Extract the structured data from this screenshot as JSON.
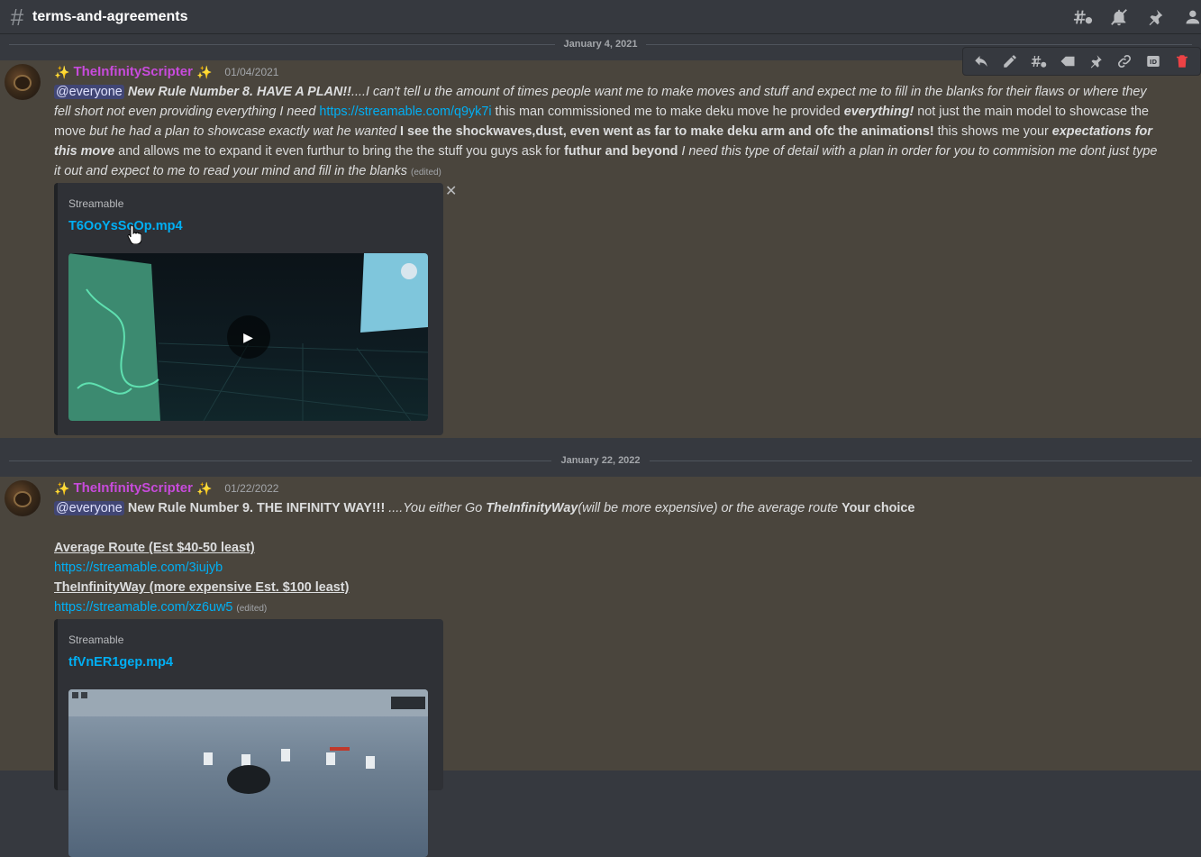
{
  "header": {
    "channel_name": "terms-and-agreements"
  },
  "messages": [
    {
      "date_divider": "January 4, 2021",
      "author": "TheInfinityScripter",
      "timestamp": "01/04/2021",
      "mention": "@everyone",
      "segments": {
        "s1": "New Rule Number 8. HAVE A PLAN!!",
        "s2": "....I can't tell u the amount of times people want me to make moves and stuff and expect me to fill in the blanks for their flaws or where they fell short not even providing everything I need ",
        "link": "https://streamable.com/q9yk7i",
        "s3": " this man commissioned me to make deku move he provided ",
        "s4": "everything!",
        "s5": " not just the main model to showcase the move ",
        "s6": "but he had a plan to showcase exactly wat he wanted ",
        "s7": " I see the shockwaves,dust, even went as far to make deku arm and ofc the animations!",
        "s8": " this shows me your ",
        "s9": "expectations for this move",
        "s10": " and allows me to expand it even furthur to bring the the stuff you guys ask for ",
        "s11": "futhur and beyond",
        "s12": " I need this type of detail with a plan in order for you to commision me dont just type it out and expect to me to read your mind and fill in the blanks",
        "edited": "(edited)"
      },
      "embed": {
        "provider": "Streamable",
        "title": "T6OoYsScOp.mp4"
      }
    },
    {
      "date_divider": "January 22, 2022",
      "author": "TheInfinityScripter",
      "timestamp": "01/22/2022",
      "mention": "@everyone",
      "segments": {
        "s1": "New Rule Number 9. THE INFINITY WAY!!!",
        "s2": " ....You either Go ",
        "s3": "TheInfinityWay",
        "s4": "(will be more expensive) or the average route ",
        "s5": "Your choice",
        "avg_title": "Average Route (Est $40-50 least)",
        "avg_link": "https://streamable.com/3iujyb",
        "inf_title": "TheInfinityWay (more expensive Est. $100 least)",
        "inf_link": "https://streamable.com/xz6uw5",
        "edited": "(edited)"
      },
      "embed": {
        "provider": "Streamable",
        "title": "tfVnER1gep.mp4"
      }
    }
  ],
  "icons": {
    "header": [
      "threads-icon",
      "mute-notifications-icon",
      "pin-icon",
      "members-icon"
    ],
    "toolbar": [
      "reply-icon",
      "edit-icon",
      "create-thread-icon",
      "mark-unread-icon",
      "pin-icon",
      "copy-link-icon",
      "copy-id-icon",
      "delete-icon"
    ]
  },
  "colors": {
    "author": "#c74bdb",
    "link": "#00aff4",
    "highlight_bg": "#4a453d",
    "delete": "#ed4245"
  }
}
